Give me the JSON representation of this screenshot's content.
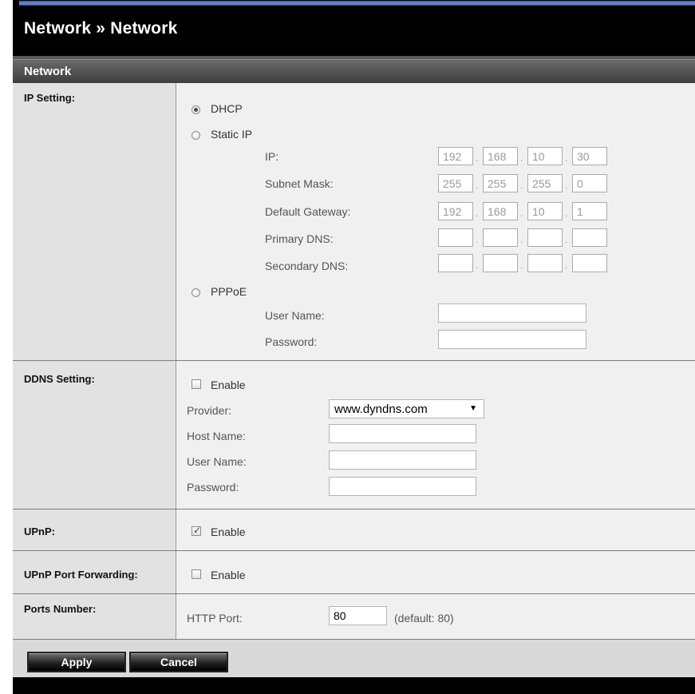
{
  "header": {
    "page_title": "Network » Network",
    "section_title": "Network"
  },
  "ip_setting": {
    "label": "IP Setting:",
    "dhcp_label": "DHCP",
    "static_ip_label": "Static IP",
    "selected": "DHCP",
    "ip_label": "IP:",
    "ip": [
      "192",
      "168",
      "10",
      "30"
    ],
    "subnet_label": "Subnet Mask:",
    "subnet": [
      "255",
      "255",
      "255",
      "0"
    ],
    "gateway_label": "Default Gateway:",
    "gateway": [
      "192",
      "168",
      "10",
      "1"
    ],
    "primary_dns_label": "Primary DNS:",
    "primary_dns": [
      "",
      "",
      "",
      ""
    ],
    "secondary_dns_label": "Secondary DNS:",
    "secondary_dns": [
      "",
      "",
      "",
      ""
    ],
    "pppoe_label": "PPPoE",
    "pppoe_user_label": "User Name:",
    "pppoe_user": "",
    "pppoe_password_label": "Password:",
    "pppoe_password": ""
  },
  "ddns": {
    "label": "DDNS Setting:",
    "enable_label": "Enable",
    "enabled": false,
    "provider_label": "Provider:",
    "provider": "www.dyndns.com",
    "host_label": "Host Name:",
    "host": "",
    "user_label": "User Name:",
    "user": "",
    "password_label": "Password:",
    "password": ""
  },
  "upnp": {
    "label": "UPnP:",
    "enable_label": "Enable",
    "enabled": true
  },
  "upnp_port_forwarding": {
    "label": "UPnP Port Forwarding:",
    "enable_label": "Enable",
    "enabled": false
  },
  "ports": {
    "label": "Ports Number:",
    "http_label": "HTTP Port:",
    "http_port": "80",
    "http_default": "(default: 80)"
  },
  "buttons": {
    "apply": "Apply",
    "cancel": "Cancel"
  }
}
